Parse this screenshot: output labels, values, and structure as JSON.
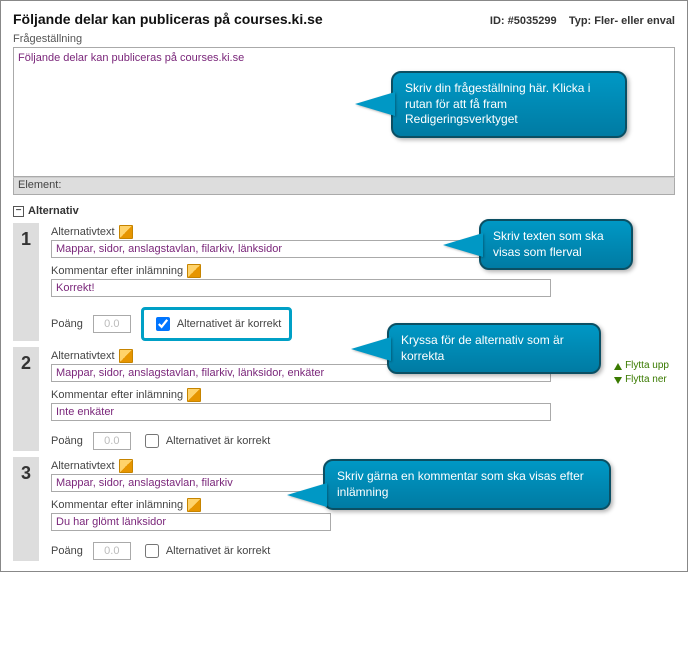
{
  "header": {
    "title": "Följande delar kan publiceras på courses.ki.se",
    "id_label": "ID:",
    "id_value": "#5035299",
    "type_label": "Typ:",
    "type_value": "Fler- eller enval"
  },
  "question": {
    "label": "Frågeställning",
    "text": "Följande delar kan publiceras på courses.ki.se",
    "element_label": "Element:"
  },
  "alt_section": {
    "heading": "Alternativ",
    "toggle": "−"
  },
  "labels": {
    "alt_text": "Alternativtext",
    "comment": "Kommentar efter inlämning",
    "points": "Poäng",
    "correct": "Alternativet är korrekt",
    "move_up": "Flytta upp",
    "move_down": "Flytta ner"
  },
  "alts": [
    {
      "num": "1",
      "text": "Mappar, sidor, anslagstavlan, filarkiv, länksidor",
      "comment": "Korrekt!",
      "points": "0.0",
      "correct": true
    },
    {
      "num": "2",
      "text": "Mappar, sidor, anslagstavlan, filarkiv, länksidor, enkäter",
      "comment": "Inte enkäter",
      "points": "0.0",
      "correct": false
    },
    {
      "num": "3",
      "text": "Mappar, sidor, anslagstavlan, filarkiv",
      "comment": "Du har glömt länksidor",
      "points": "0.0",
      "correct": false
    }
  ],
  "tips": {
    "t1": "Skriv din frågeställning här. Klicka i rutan för att få fram Redigeringsverktyget",
    "t2": "Skriv texten som ska visas som flerval",
    "t3": "Kryssa för de alternativ som är korrekta",
    "t4": "Skriv gärna en kommentar som ska visas efter inlämning"
  }
}
